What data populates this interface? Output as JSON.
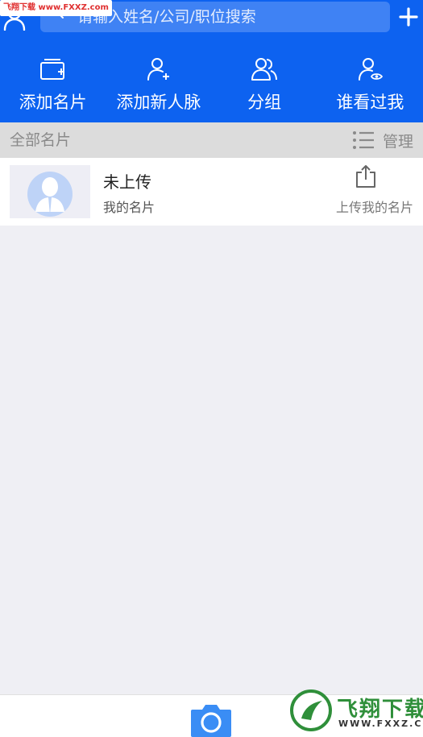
{
  "watermark": {
    "top_text": "飞翔下载 www.FXXZ.com",
    "bottom_brand": "飞翔下载",
    "bottom_url": "WWW.FXXZ.COM"
  },
  "header": {
    "search_placeholder": "请输入姓名/公司/职位搜索",
    "search_value": ""
  },
  "actions": [
    {
      "label": "添加名片",
      "icon": "add-card-icon"
    },
    {
      "label": "添加新人脉",
      "icon": "add-contact-icon"
    },
    {
      "label": "分组",
      "icon": "group-icon"
    },
    {
      "label": "谁看过我",
      "icon": "viewer-icon"
    }
  ],
  "section": {
    "title": "全部名片",
    "manage_label": "管理"
  },
  "card": {
    "title": "未上传",
    "subtitle": "我的名片",
    "upload_label": "上传我的名片"
  },
  "colors": {
    "brand_blue": "#0d62f0",
    "background": "#efeff4",
    "camera_blue": "#3a8df5"
  }
}
